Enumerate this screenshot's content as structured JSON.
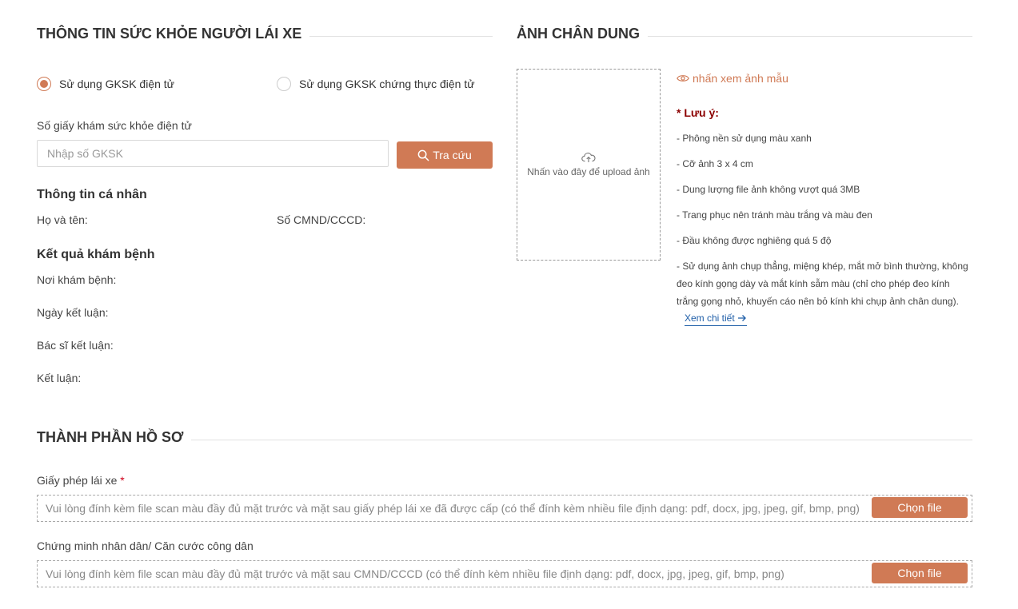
{
  "health": {
    "title": "THÔNG TIN SỨC KHỎE NGƯỜI LÁI XE",
    "radio_electronic": "Sử dụng GKSK điện tử",
    "radio_certified": "Sử dụng GKSK chứng thực điện tử",
    "selected": "electronic",
    "number_label": "Số giấy khám sức khỏe điện tử",
    "number_placeholder": "Nhập số GKSK",
    "number_value": "",
    "search_button": "Tra cứu",
    "personal_heading": "Thông tin cá nhân",
    "fullname_label": "Họ và tên:",
    "id_label": "Số CMND/CCCD:",
    "result_heading": "Kết quả khám bệnh",
    "place_label": "Nơi khám bệnh:",
    "date_label": "Ngày kết luận:",
    "doctor_label": "Bác sĩ kết luận:",
    "conclusion_label": "Kết luận:"
  },
  "portrait": {
    "title": "ẢNH CHÂN DUNG",
    "upload_text": "Nhấn vào đây để upload ảnh",
    "sample_link": "nhấn xem ảnh mẫu",
    "note_title": "* Lưu ý:",
    "notes": [
      "- Phông nền sử dụng màu xanh",
      "- Cỡ ảnh 3 x 4 cm",
      "- Dung lượng file ảnh không vượt quá 3MB",
      "- Trang phục nên tránh màu trắng và màu đen",
      "- Đầu không được nghiêng quá 5 độ",
      "- Sử dụng ảnh chụp thẳng, miệng khép, mắt mở bình thường, không đeo kính gọng dày và mắt kính sẫm màu (chỉ cho phép đeo kính trắng gọng nhỏ, khuyến cáo nên bỏ kính khi chụp ảnh chân dung)."
    ],
    "detail_link": "Xem chi tiết"
  },
  "dossier": {
    "title": "THÀNH PHẦN HỒ SƠ",
    "license_label": "Giấy phép lái xe",
    "required_mark": "*",
    "license_hint": "Vui lòng đính kèm file scan màu đầy đủ mặt trước và mặt sau giấy phép lái xe đã được cấp (có thể đính kèm nhiều file định dạng: pdf, docx, jpg, jpeg, gif, bmp, png)",
    "id_label": "Chứng minh nhân dân/ Căn cước công dân",
    "id_hint": "Vui lòng đính kèm file scan màu đầy đủ mặt trước và mặt sau CMND/CCCD (có thể đính kèm nhiều file định dạng: pdf, docx, jpg, jpeg, gif, bmp, png)",
    "choose_file": "Chọn file"
  },
  "colors": {
    "accent": "#d07a55",
    "note_red": "#8b0000",
    "link_blue": "#1f5ea8"
  }
}
